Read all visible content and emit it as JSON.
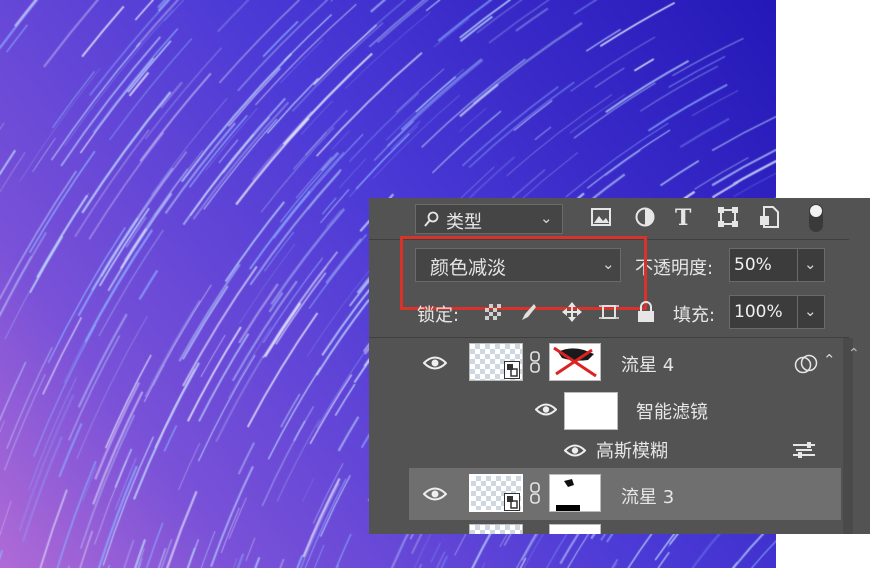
{
  "canvas": {
    "name": "star-trails-photo",
    "colors": [
      "#2418b8",
      "#4b3ad6",
      "#7a52d8",
      "#b06bd6"
    ]
  },
  "toolbar": {
    "filter_search_icon": "search-icon",
    "filter_label": "类型",
    "icons": [
      "image-filter-icon",
      "adjustment-filter-icon",
      "type-filter-icon",
      "shape-filter-icon",
      "smart-object-filter-icon"
    ]
  },
  "blend": {
    "mode": "颜色减淡",
    "opacity_label": "不透明度:",
    "opacity": "50%"
  },
  "lock": {
    "label": "锁定:",
    "fill_label": "填充:",
    "fill": "100%"
  },
  "layers": [
    {
      "name": "流星 4",
      "has_mask": true,
      "selected": false
    },
    {
      "name": "智能滤镜",
      "type": "smart-filters"
    },
    {
      "name": "高斯模糊",
      "type": "filter"
    },
    {
      "name": "流星 3",
      "has_mask": true,
      "selected": true
    }
  ],
  "highlight_color": "#d9322b"
}
